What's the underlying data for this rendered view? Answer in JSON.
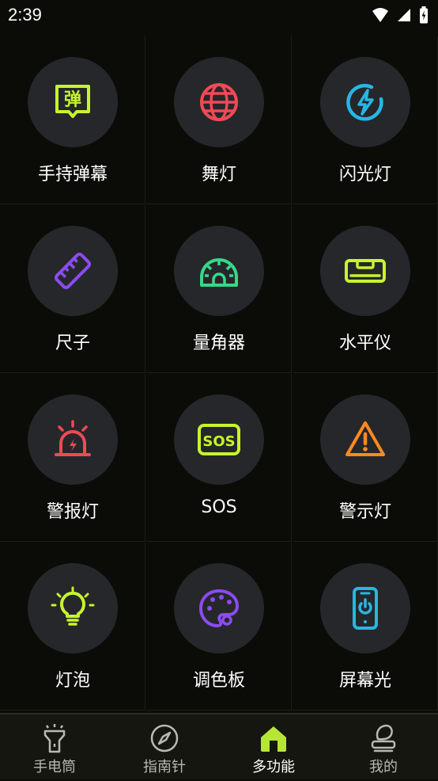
{
  "status_bar": {
    "time": "2:39"
  },
  "features": [
    {
      "label": "手持弹幕",
      "icon": "handheld-barrage-icon",
      "color": "#c6f52c",
      "glyph": "弹"
    },
    {
      "label": "舞灯",
      "icon": "disco-ball-icon",
      "color": "#f04a55"
    },
    {
      "label": "闪光灯",
      "icon": "flash-icon",
      "color": "#27b6e6"
    },
    {
      "label": "尺子",
      "icon": "ruler-icon",
      "color": "#8b4cf0"
    },
    {
      "label": "量角器",
      "icon": "protractor-icon",
      "color": "#35d98a"
    },
    {
      "label": "水平仪",
      "icon": "level-icon",
      "color": "#c6f52c"
    },
    {
      "label": "警报灯",
      "icon": "alarm-light-icon",
      "color": "#f04a55"
    },
    {
      "label": "SOS",
      "icon": "sos-icon",
      "color": "#c6f52c",
      "glyph": "SOS"
    },
    {
      "label": "警示灯",
      "icon": "warning-icon",
      "color": "#ff8a1f"
    },
    {
      "label": "灯泡",
      "icon": "light-bulb-icon",
      "color": "#c6f52c"
    },
    {
      "label": "调色板",
      "icon": "palette-icon",
      "color": "#8b4cf0"
    },
    {
      "label": "屏幕光",
      "icon": "screen-light-icon",
      "color": "#27b6e6"
    }
  ],
  "bottom_nav": {
    "tabs": [
      {
        "label": "手电筒",
        "icon": "flashlight-icon",
        "active": false
      },
      {
        "label": "指南针",
        "icon": "compass-icon",
        "active": false
      },
      {
        "label": "多功能",
        "icon": "home-icon",
        "active": true
      },
      {
        "label": "我的",
        "icon": "profile-icon",
        "active": false
      }
    ],
    "active_color": "#b5e634",
    "inactive_color": "#b9b9b3"
  }
}
